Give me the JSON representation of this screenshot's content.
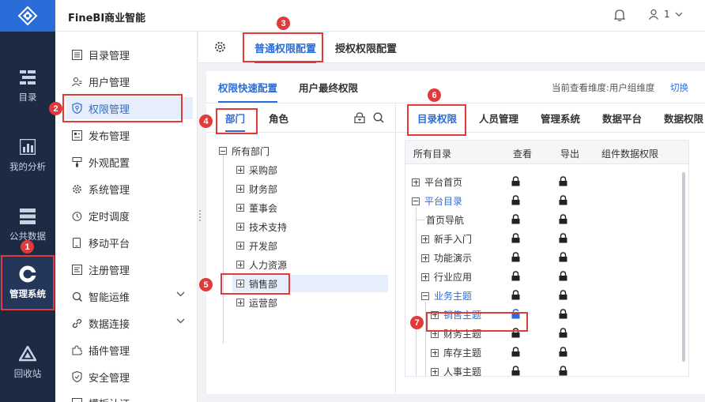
{
  "nav": {
    "items": [
      {
        "label": "目录",
        "icon": "catalog-icon"
      },
      {
        "label": "我的分析",
        "icon": "analysis-icon"
      },
      {
        "label": "公共数据",
        "icon": "public-data-icon"
      },
      {
        "label": "管理系统",
        "icon": "management-icon"
      },
      {
        "label": "回收站",
        "icon": "recycle-icon"
      }
    ]
  },
  "header": {
    "brand": "FineBI商业智能",
    "user": "1"
  },
  "sidebar": {
    "items": [
      {
        "label": "目录管理"
      },
      {
        "label": "用户管理"
      },
      {
        "label": "权限管理"
      },
      {
        "label": "发布管理"
      },
      {
        "label": "外观配置"
      },
      {
        "label": "系统管理"
      },
      {
        "label": "定时调度"
      },
      {
        "label": "移动平台"
      },
      {
        "label": "注册管理"
      },
      {
        "label": "智能运维"
      },
      {
        "label": "数据连接"
      },
      {
        "label": "插件管理"
      },
      {
        "label": "安全管理"
      },
      {
        "label": "模板认证"
      }
    ]
  },
  "topbar": {
    "tabs": [
      "普通权限配置",
      "授权权限配置"
    ]
  },
  "subtabs": {
    "tabs": [
      "权限快速配置",
      "用户最终权限"
    ],
    "view_dim": "当前查看维度:用户组维度",
    "switch": "切换"
  },
  "left_pane": {
    "tabs": [
      "部门",
      "角色"
    ],
    "root": "所有部门",
    "departments": [
      "采购部",
      "财务部",
      "董事会",
      "技术支持",
      "开发部",
      "人力资源",
      "销售部",
      "运营部"
    ]
  },
  "right_pane": {
    "tabs": [
      "目录权限",
      "人员管理",
      "管理系统",
      "数据平台",
      "数据权限"
    ],
    "columns": [
      "所有目录",
      "查看",
      "导出",
      "组件数据权限"
    ],
    "rows": [
      {
        "name": "平台首页"
      },
      {
        "name": "平台目录"
      },
      {
        "name": "首页导航"
      },
      {
        "name": "新手入门"
      },
      {
        "name": "功能演示"
      },
      {
        "name": "行业应用"
      },
      {
        "name": "业务主题"
      },
      {
        "name": "销售主题"
      },
      {
        "name": "财务主题"
      },
      {
        "name": "库存主题"
      },
      {
        "name": "人事主题"
      }
    ]
  },
  "markers": [
    "1",
    "2",
    "3",
    "4",
    "5",
    "6",
    "7"
  ],
  "colors": {
    "accent": "#2b6dd8",
    "nav_bg": "#1c2a44",
    "annotation": "#e03a3a"
  }
}
